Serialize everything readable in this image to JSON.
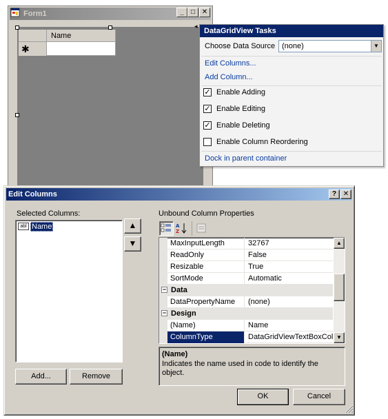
{
  "form": {
    "title": "Form1",
    "caption_buttons": [
      "_",
      "□",
      "✕"
    ],
    "grid": {
      "column_header": "Name",
      "new_row_glyph": "✱"
    }
  },
  "tasks": {
    "title": "DataGridView Tasks",
    "choose_data_source_label": "Choose Data Source",
    "data_source_value": "(none)",
    "edit_columns_link": "Edit Columns...",
    "add_column_link": "Add Column...",
    "enable_adding": {
      "label": "Enable Adding",
      "checked": true
    },
    "enable_editing": {
      "label": "Enable Editing",
      "checked": true
    },
    "enable_deleting": {
      "label": "Enable Deleting",
      "checked": true
    },
    "enable_reordering": {
      "label": "Enable Column Reordering",
      "checked": false
    },
    "dock_link": "Dock in parent container",
    "smart_tag_glyph": "◂"
  },
  "dialog": {
    "title": "Edit Columns",
    "help_button": "?",
    "close_button": "✕",
    "selected_columns_label": "Selected Columns:",
    "column_items": [
      {
        "type_glyph": "abl",
        "label": "Name"
      }
    ],
    "move_up_glyph": "▲",
    "move_down_glyph": "▼",
    "add_button": "Add...",
    "remove_button": "Remove",
    "properties_label": "Unbound Column Properties",
    "properties": [
      {
        "name": "MaxInputLength",
        "value": "32767"
      },
      {
        "name": "ReadOnly",
        "value": "False"
      },
      {
        "name": "Resizable",
        "value": "True"
      },
      {
        "name": "SortMode",
        "value": "Automatic"
      }
    ],
    "category_data": {
      "label": "Data",
      "toggle": "−"
    },
    "data_properties": [
      {
        "name": "DataPropertyName",
        "value": "(none)"
      }
    ],
    "category_design": {
      "label": "Design",
      "toggle": "−"
    },
    "design_properties": [
      {
        "name": "(Name)",
        "value": "Name"
      },
      {
        "name": "ColumnType",
        "value": "DataGridViewTextBoxColu"
      }
    ],
    "description_title": "(Name)",
    "description_text": "Indicates the name used in code to identify the object.",
    "ok_button": "OK",
    "cancel_button": "Cancel",
    "scroll_up_glyph": "▲",
    "scroll_down_glyph": "▼"
  }
}
